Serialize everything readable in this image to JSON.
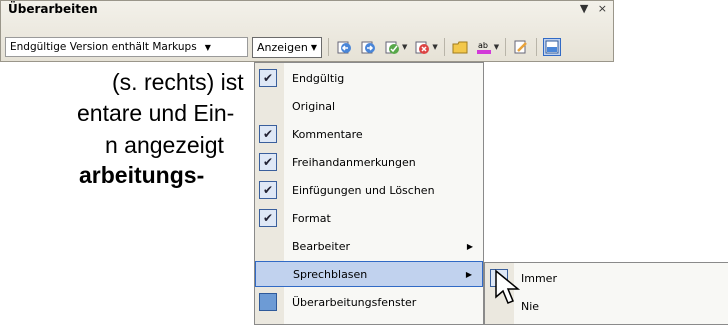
{
  "doc": {
    "lines": [
      {
        "text": "(s. rechts) ist",
        "bold": false
      },
      {
        "text": "entare und Ein-",
        "bold": false
      },
      {
        "text": "n angezeigt",
        "bold": false
      },
      {
        "text": "arbeitungs-",
        "bold": true
      }
    ]
  },
  "toolbar": {
    "title": "Überarbeiten",
    "dropdown_glyph": "▼",
    "close_glyph": "×",
    "combo_value": "Endgültige Version enthält Markups",
    "anzeigen_label": "Anzeigen"
  },
  "menu": {
    "items": [
      {
        "label": "Endgültig",
        "checked": true
      },
      {
        "label": "Original",
        "checked": false
      },
      {
        "label": "Kommentare",
        "checked": true
      },
      {
        "label": "Freihandanmerkungen",
        "checked": true
      },
      {
        "label": "Einfügungen und Löschen",
        "checked": true
      },
      {
        "label": "Format",
        "checked": true
      },
      {
        "label": "Bearbeiter",
        "checked": false
      },
      {
        "label": "Sprechblasen",
        "checked": false
      },
      {
        "label": "Überarbeitungsfenster",
        "checked": false
      }
    ]
  },
  "submenu": {
    "items": [
      {
        "label": "Immer",
        "checked": true
      },
      {
        "label": "Nie",
        "checked": false
      }
    ]
  }
}
